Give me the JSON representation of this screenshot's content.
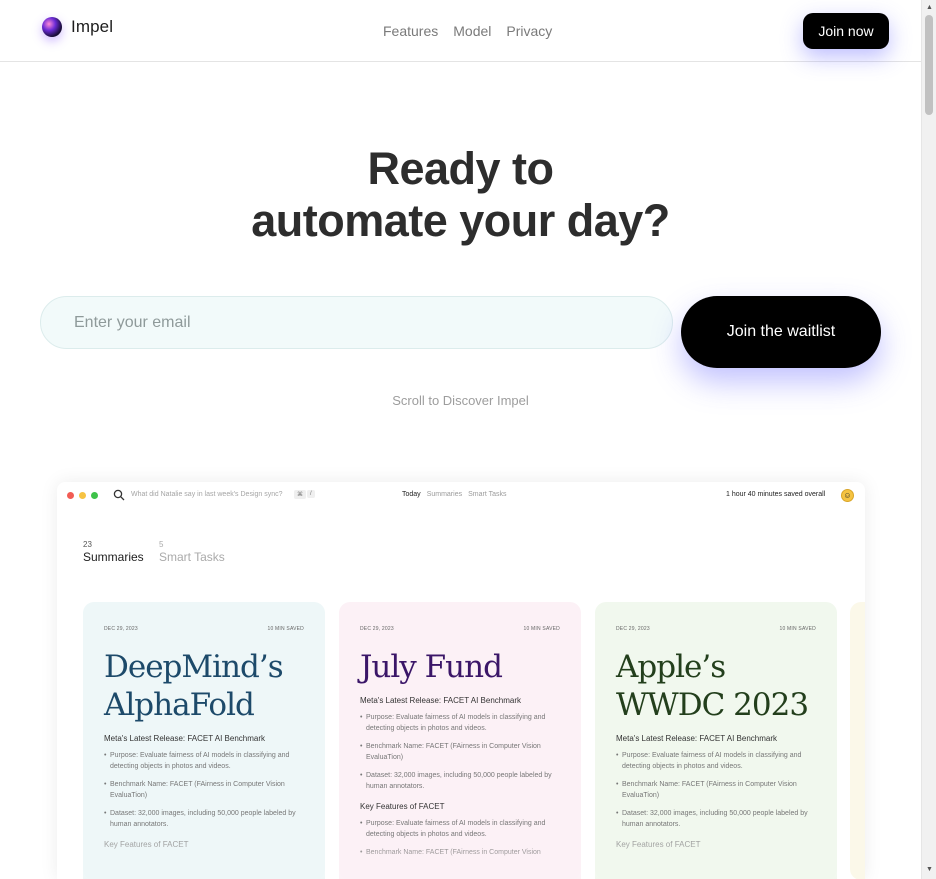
{
  "header": {
    "brand": "Impel",
    "nav": [
      "Features",
      "Model",
      "Privacy"
    ],
    "cta": "Join now"
  },
  "hero": {
    "title_line1": "Ready to",
    "title_line2": "automate your day?",
    "email_placeholder": "Enter your email",
    "submit": "Join the waitlist",
    "scroll_hint": "Scroll to Discover Impel"
  },
  "app": {
    "search_placeholder": "What did Natalie say in last week's Design sync?",
    "shortcut_keys": [
      "⌘",
      "/"
    ],
    "tabs": [
      "Today",
      "Summaries",
      "Smart Tasks"
    ],
    "active_tab": "Today",
    "saved_overall": "1 hour 40 minutes saved overall",
    "avatar_glyph": "☺",
    "counts": [
      {
        "num": "23",
        "label": "Summaries",
        "active": true
      },
      {
        "num": "5",
        "label": "Smart Tasks",
        "active": false
      }
    ],
    "cards": [
      {
        "date": "DEC 29, 2023",
        "saved": "10 MIN SAVED",
        "title": "DeepMind’s AlphaFold",
        "title_color": "#1d4a6a",
        "bg": "#eef7f8",
        "subtitle": "Meta's Latest Release: FACET AI Benchmark",
        "bullets": [
          "Purpose: Evaluate fairness of AI models in classifying and detecting objects in photos and videos.",
          "Benchmark Name: FACET (FAirness in Computer Vision EvaluaTion)",
          "Dataset: 32,000 images, including 50,000 people labeled by human annotators."
        ],
        "subtitle2": "Key Features of FACET",
        "bullets2": []
      },
      {
        "date": "DEC 29, 2023",
        "saved": "10 MIN SAVED",
        "title": "July Fund",
        "title_color": "#3b1668",
        "bg": "#fcf1f6",
        "subtitle": "Meta's Latest Release: FACET AI Benchmark",
        "bullets": [
          "Purpose: Evaluate fairness of AI models in classifying and detecting objects in photos and videos.",
          "Benchmark Name: FACET (FAirness in Computer Vision EvaluaTion)",
          "Dataset: 32,000 images, including 50,000 people labeled by human annotators."
        ],
        "subtitle2": "Key Features of FACET",
        "bullets2": [
          "Purpose: Evaluate fairness of AI models in classifying and detecting objects in photos and videos.",
          "Benchmark Name: FACET (FAirness in Computer Vision"
        ]
      },
      {
        "date": "DEC 29, 2023",
        "saved": "10 MIN SAVED",
        "title": "Apple’s WWDC 2023",
        "title_color": "#233f1c",
        "bg": "#f1f8ee",
        "subtitle": "Meta's Latest Release: FACET AI Benchmark",
        "bullets": [
          "Purpose: Evaluate fairness of AI models in classifying and detecting objects in photos and videos.",
          "Benchmark Name: FACET (FAirness in Computer Vision EvaluaTion)",
          "Dataset: 32,000 images, including 50,000 people labeled by human annotators."
        ],
        "subtitle2": "Key Features of FACET",
        "bullets2": []
      }
    ]
  },
  "colors": {
    "accent_shadow": "#7878ff",
    "button": "#000000",
    "input_bg": "#f2fafa"
  }
}
